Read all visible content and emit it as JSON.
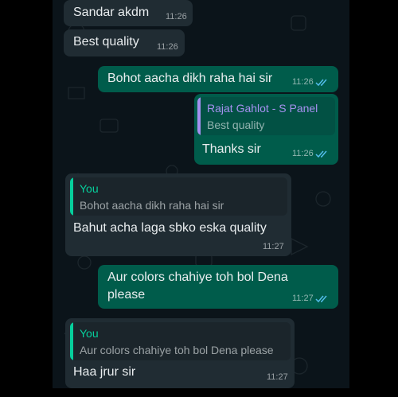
{
  "colors": {
    "background": "#0b141a",
    "incoming_bubble": "#202c33",
    "outgoing_bubble": "#005c4b",
    "read_ticks": "#53bdeb",
    "quote_you_accent": "#06cf9c",
    "quote_contact_accent": "#a591f0"
  },
  "messages": [
    {
      "direction": "in",
      "text": "Sandar akdm",
      "time": "11:26"
    },
    {
      "direction": "in",
      "text": "Best quality",
      "time": "11:26"
    },
    {
      "direction": "out",
      "text": "Bohot aacha dikh raha hai sir",
      "time": "11:26",
      "status": "read"
    },
    {
      "direction": "out",
      "quoted_author": "Rajat Gahlot - S Panel",
      "quoted_text": "Best quality",
      "text": "Thanks sir",
      "time": "11:26",
      "status": "read"
    },
    {
      "direction": "in",
      "quoted_author": "You",
      "quoted_text": "Bohot aacha dikh raha hai sir",
      "text": "Bahut acha laga sbko eska quality",
      "time": "11:27"
    },
    {
      "direction": "out",
      "text": "Aur colors chahiye toh bol Dena\nplease",
      "time": "11:27",
      "status": "read"
    },
    {
      "direction": "in",
      "quoted_author": "You",
      "quoted_text": "Aur colors chahiye toh bol Dena please",
      "text": "Haa jrur sir",
      "time": "11:27"
    }
  ]
}
